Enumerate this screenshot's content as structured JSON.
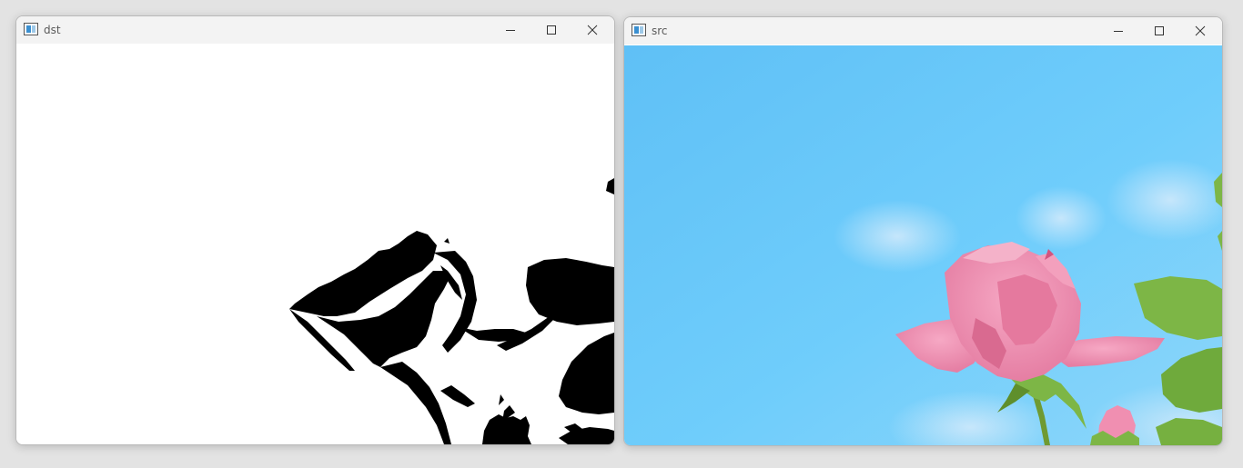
{
  "windows": [
    {
      "title": "dst",
      "icon": "image-window-icon",
      "controls": [
        "minimize-icon",
        "maximize-icon",
        "close-icon"
      ],
      "content": "binary-threshold-image"
    },
    {
      "title": "src",
      "icon": "image-window-icon",
      "controls": [
        "minimize-icon",
        "maximize-icon",
        "close-icon"
      ],
      "content": "pink-rose-photo"
    }
  ],
  "colors": {
    "titlebar": "#f3f3f3",
    "sky": "#6cc9f8",
    "rose": "#f08fb1",
    "leaf": "#7db646",
    "mask_fg": "#000000",
    "mask_bg": "#ffffff"
  }
}
